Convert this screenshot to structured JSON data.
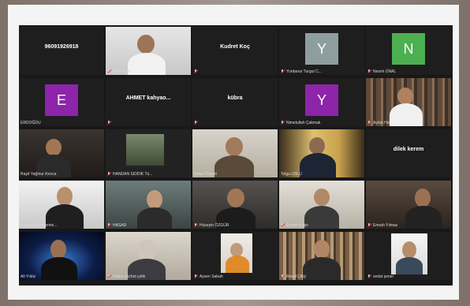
{
  "meeting": {
    "participants": [
      {
        "label": "96091926918",
        "type": "text"
      },
      {
        "label": "Ömer Cirit",
        "type": "video"
      },
      {
        "label": "Kudret Koç",
        "type": "text"
      },
      {
        "label": "Yurdanur Turgut C...",
        "type": "avatar",
        "initial": "Y",
        "color": "#8e9ea0"
      },
      {
        "label": "Nesrin ÜNAL",
        "type": "avatar",
        "initial": "N",
        "color": "#4caf50"
      },
      {
        "label": "ERDOĞDU",
        "type": "avatar",
        "initial": "E",
        "color": "#8e24aa"
      },
      {
        "label": "AHMET kahyao...",
        "type": "text"
      },
      {
        "label": "kübra",
        "type": "text"
      },
      {
        "label": "Nimetullah Çakmak",
        "type": "avatar",
        "initial": "Y",
        "color": "#8e24aa"
      },
      {
        "label": "Aydın Hiz...",
        "type": "video"
      },
      {
        "label": "Raşit Yağmur Konca",
        "type": "video"
      },
      {
        "label": "HANDAN SIDDIK Tü...",
        "type": "video"
      },
      {
        "label": "Sinan Özyurt",
        "type": "video"
      },
      {
        "label": "Tolga USLU",
        "type": "video"
      },
      {
        "label": "dilek kerem",
        "type": "text"
      },
      {
        "label": "Suhal Bağcı/Verimi...",
        "type": "video"
      },
      {
        "label": "HASAR",
        "type": "video"
      },
      {
        "label": "Hüseyin ÖZGÜR",
        "type": "video"
      },
      {
        "label": "Erdem Ergin",
        "type": "video"
      },
      {
        "label": "Emrah Yılmaz",
        "type": "video"
      },
      {
        "label": "Ali Yıldız",
        "type": "video"
      },
      {
        "label": "hatice nüzhet çelik",
        "type": "video"
      },
      {
        "label": "Aysen Sabah",
        "type": "video"
      },
      {
        "label": "Resul Çiftçi",
        "type": "video"
      },
      {
        "label": "sedat şener",
        "type": "video"
      }
    ]
  },
  "active_speaker": "Sinan Özyurt"
}
